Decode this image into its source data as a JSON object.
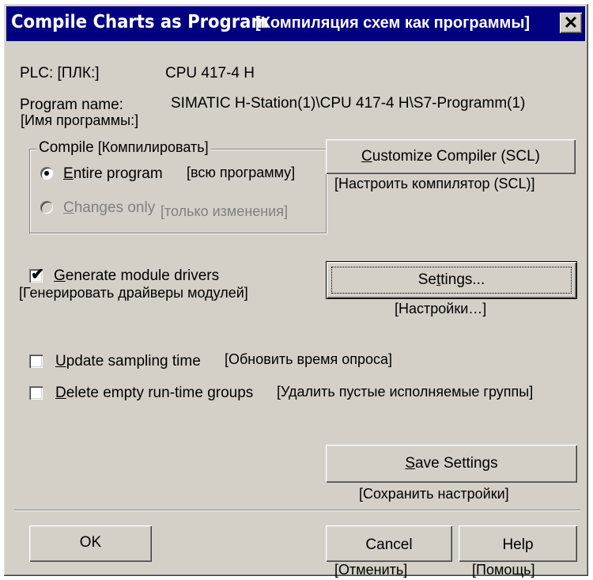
{
  "window": {
    "title": "Compile Charts as Program",
    "title_ru": "[Компиляция схем как программы]",
    "close_glyph": "✕"
  },
  "plc": {
    "label": "PLC: [ПЛК:]",
    "value": "CPU 417-4 H"
  },
  "program": {
    "label": "Program name:",
    "value": "SIMATIC H-Station(1)\\CPU 417-4 H\\S7-Programm(1)",
    "label_ru": "[Имя программы:]"
  },
  "compile_group": {
    "title": "Compile",
    "title_ru": "[Компилировать]",
    "options": [
      {
        "pre": "",
        "accel": "E",
        "post": "ntire program",
        "ru": "[всю программу]",
        "selected": true,
        "enabled": true
      },
      {
        "pre": "",
        "accel": "C",
        "post": "hanges only",
        "ru": "[только изменения]",
        "selected": false,
        "enabled": false
      }
    ]
  },
  "customize_button": {
    "pre": "",
    "accel": "C",
    "post": "ustomize Compiler (SCL)",
    "ru": "[Настроить компилятор (SCL)]"
  },
  "checkboxes": [
    {
      "pre": "",
      "accel": "G",
      "post": "enerate module drivers",
      "ru": "[Генерировать драйверы модулей]",
      "checked": true
    },
    {
      "pre": "",
      "accel": "U",
      "post": "pdate sampling time",
      "ru": "[Обновить время опроса]",
      "checked": false
    },
    {
      "pre": "",
      "accel": "D",
      "post": "elete empty run-time groups",
      "ru": "[Удалить пустые исполняемые группы]",
      "checked": false
    }
  ],
  "settings_button": {
    "pre": "Se",
    "accel": "t",
    "post": "tings...",
    "ru": "[Настройки…]"
  },
  "save_button": {
    "pre": "",
    "accel": "S",
    "post": "ave Settings",
    "ru": "[Сохранить настройки]"
  },
  "footer": {
    "ok": "OK",
    "cancel": "Cancel",
    "cancel_ru": "[Отменить]",
    "help": "Help",
    "help_ru": "[Помощь]"
  },
  "check_glyph": "✔"
}
